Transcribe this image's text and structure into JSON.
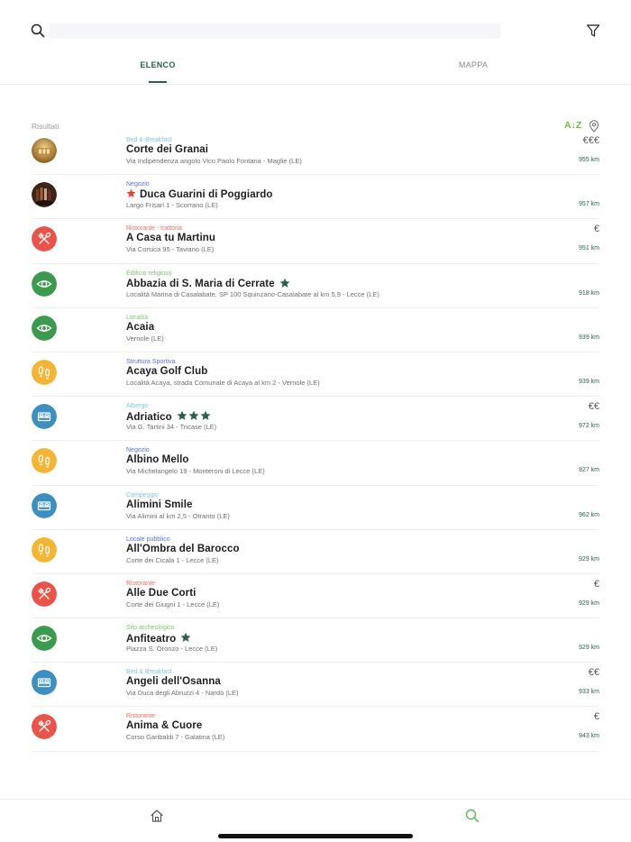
{
  "search": {
    "placeholder": "",
    "value": ""
  },
  "tabs": [
    {
      "label": "ELENCO",
      "active": true
    },
    {
      "label": "MAPPA",
      "active": false
    }
  ],
  "results": {
    "label": "Risultati",
    "sort_label": "A↓Z"
  },
  "colors": {
    "accent_green": "#2a6048",
    "sort_green": "#6cbd3a",
    "restaurant_red": "#e8534a",
    "sight_green": "#3c9a4e",
    "shop_orange": "#f2b535",
    "lodging_blue": "#3d8fbf"
  },
  "items": [
    {
      "category": "Bed & Breakfast",
      "category_color": "#7fc5de",
      "name": "Corte dei Granai",
      "address": "Via Indipendenza angolo Vico Paolo Fontana - Maglie (LE)",
      "price": "€€€",
      "distance": "955 km",
      "icon": "photo-courtyard",
      "pre_star": false,
      "stars": 0
    },
    {
      "category": "Negozio",
      "category_color": "#5b6ee1",
      "name": "Duca Guarini di Poggiardo",
      "address": "Largo Frisari 1 - Scorrano (LE)",
      "price": "",
      "distance": "957 km",
      "icon": "photo-wine",
      "pre_star": true,
      "stars": 0
    },
    {
      "category": "Ristorante - trattoria",
      "category_color": "#ec6a62",
      "name": "A Casa tu Martinu",
      "address": "Via Corsica 95 - Taviano (LE)",
      "price": "€",
      "distance": "951 km",
      "icon": "cutlery-icon",
      "pre_star": false,
      "stars": 0
    },
    {
      "category": "Edificio religioso",
      "category_color": "#7dc36c",
      "name": "Abbazia di S. Maria di Cerrate",
      "address": "Località Marina di Casalabate, SP 100 Squinzano-Casalabate al km 5,9 - Lecce (LE)",
      "price": "",
      "distance": "918 km",
      "icon": "eye-icon",
      "pre_star": false,
      "stars": 1
    },
    {
      "category": "Località",
      "category_color": "#7dc36c",
      "name": "Acaia",
      "address": "Vernole (LE)",
      "price": "",
      "distance": "939 km",
      "icon": "eye-icon",
      "pre_star": false,
      "stars": 0
    },
    {
      "category": "Struttura Sportiva",
      "category_color": "#5b6ee1",
      "name": "Acaya Golf Club",
      "address": "Località Acaya, strada Comunale di Acaya al km 2 - Vernole (LE)",
      "price": "",
      "distance": "939 km",
      "icon": "footprints-icon",
      "pre_star": false,
      "stars": 0
    },
    {
      "category": "Albergo",
      "category_color": "#7fc5de",
      "name": "Adriatico",
      "address": "Via G. Tartini 34 - Tricase (LE)",
      "price": "€€",
      "distance": "972 km",
      "icon": "bed-icon",
      "pre_star": false,
      "stars": 3
    },
    {
      "category": "Negozio",
      "category_color": "#5b6ee1",
      "name": "Albino Mello",
      "address": "Via Michelangelo 19 - Monteroni di Lecce (LE)",
      "price": "",
      "distance": "927 km",
      "icon": "footprints-icon",
      "pre_star": false,
      "stars": 0
    },
    {
      "category": "Campeggio",
      "category_color": "#7fc5de",
      "name": "Alimini Smile",
      "address": "Via Alimini al km 2,5 - Otranto (LE)",
      "price": "",
      "distance": "962 km",
      "icon": "bed-icon",
      "pre_star": false,
      "stars": 0
    },
    {
      "category": "Locale pubblico",
      "category_color": "#5b6ee1",
      "name": "All'Ombra del Barocco",
      "address": "Corte dei Cicala 1 - Lecce (LE)",
      "price": "",
      "distance": "929 km",
      "icon": "footprints-icon",
      "pre_star": false,
      "stars": 0
    },
    {
      "category": "Ristorante",
      "category_color": "#ec6a62",
      "name": "Alle Due Corti",
      "address": "Corte dei Giugni 1 - Lecce (LE)",
      "price": "€",
      "distance": "929 km",
      "icon": "cutlery-icon",
      "pre_star": false,
      "stars": 0
    },
    {
      "category": "Sito archeologico",
      "category_color": "#7dc36c",
      "name": "Anfiteatro",
      "address": "Piazza S. Oronzo - Lecce (LE)",
      "price": "",
      "distance": "929 km",
      "icon": "eye-icon",
      "pre_star": false,
      "stars": 1
    },
    {
      "category": "Bed & Breakfast",
      "category_color": "#7fc5de",
      "name": "Angeli dell'Osanna",
      "address": "Via Duca degli Abruzzi 4 - Nardò (LE)",
      "price": "€€",
      "distance": "933 km",
      "icon": "bed-icon",
      "pre_star": false,
      "stars": 0
    },
    {
      "category": "Ristorante",
      "category_color": "#ec6a62",
      "name": "Anima & Cuore",
      "address": "Corso Garibaldi 7 - Galatina (LE)",
      "price": "€",
      "distance": "943 km",
      "icon": "cutlery-icon",
      "pre_star": false,
      "stars": 0
    }
  ],
  "bottom_nav": [
    {
      "icon": "home-icon",
      "active": false
    },
    {
      "icon": "search-icon",
      "active": true
    }
  ]
}
